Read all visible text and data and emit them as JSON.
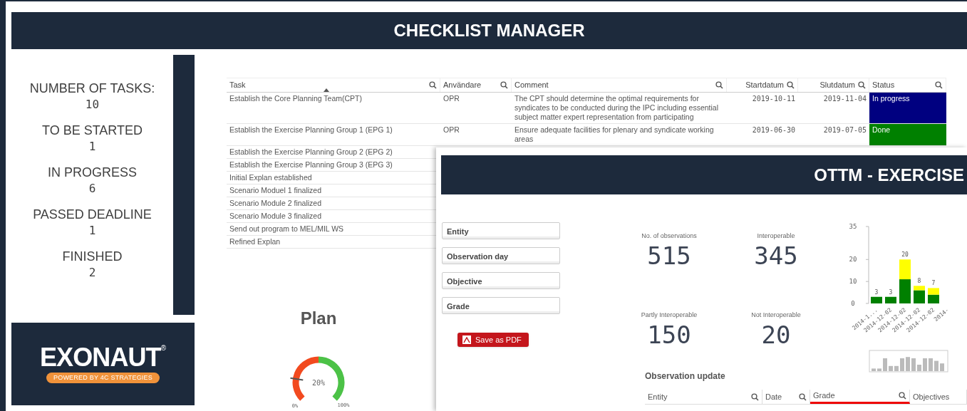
{
  "header": {
    "title": "CHECKLIST MANAGER"
  },
  "summary": [
    {
      "label": "NUMBER OF TASKS:",
      "value": "10"
    },
    {
      "label": "TO BE STARTED",
      "value": "1"
    },
    {
      "label": "IN PROGRESS",
      "value": "6"
    },
    {
      "label": "PASSED DEADLINE",
      "value": "1"
    },
    {
      "label": "FINISHED",
      "value": "2"
    }
  ],
  "logo": {
    "name": "EXONAUT",
    "mark": "®",
    "tagline": "POWERED BY 4C STRATEGIES"
  },
  "task_table": {
    "columns": [
      {
        "label": "Task",
        "sorted": true,
        "kind": "text"
      },
      {
        "label": "Användare",
        "sorted": false,
        "kind": "text"
      },
      {
        "label": "Comment",
        "sorted": false,
        "kind": "text"
      },
      {
        "label": "Startdatum",
        "sorted": false,
        "kind": "date"
      },
      {
        "label": "Slutdatum",
        "sorted": false,
        "kind": "date"
      },
      {
        "label": "Status",
        "sorted": false,
        "kind": "text"
      }
    ],
    "rows": [
      {
        "task": "Establish the Core Planning Team(CPT)",
        "user": "OPR",
        "comment": "The CPT should determine the optimal requirements for syndicates to be conducted during the IPC including essential subject matter expert representation from participating",
        "start": "2019-10-11",
        "end": "2019-11-04",
        "status": "In progress",
        "color": "#000080"
      },
      {
        "task": "Establish the Exercise Planning Group 1 (EPG 1)",
        "user": "OPR",
        "comment": "Ensure adequate facilities for plenary and syndicate working areas",
        "start": "2019-06-30",
        "end": "2019-07-05",
        "status": "Done",
        "color": "#008000"
      },
      {
        "task": "Establish the Exercise Planning Group 2 (EPG 2)"
      },
      {
        "task": "Establish the Exercise Planning Group 3 (EPG 3)"
      },
      {
        "task": "Initial Explan established"
      },
      {
        "task": "Scenario Moduel 1 finalized"
      },
      {
        "task": "Scenario Module 2 finalized"
      },
      {
        "task": "Scenario Module 3 finalized"
      },
      {
        "task": "Send out program to MEL/MIL WS"
      },
      {
        "task": "Refined Explan"
      }
    ]
  },
  "plan": {
    "title": "Plan",
    "level": 0.2,
    "reading": "20%",
    "min_label": "0%",
    "max_label": "100%"
  },
  "exercise_window": {
    "title": "OTTM - EXERCISE",
    "filters": [
      "Entity",
      "Observation day",
      "Objective",
      "Grade"
    ],
    "save_button": "Save as PDF",
    "kpis": [
      {
        "label": "No. of observations",
        "value": "515"
      },
      {
        "label": "Interoperable",
        "value": "345"
      },
      {
        "label": "Partly Interoperable",
        "value": "150"
      },
      {
        "label": "Not Interoperable",
        "value": "20"
      }
    ],
    "chart_data": {
      "type": "bar",
      "stacked": true,
      "categories": [
        "2014-1...",
        "2014-12-02",
        "2014-12-02",
        "2014-12-02",
        "2014-12-02",
        "2014-"
      ],
      "series": [
        {
          "color": "#008000",
          "values": [
            3,
            3,
            11,
            6,
            4,
            null
          ]
        },
        {
          "color": "#ffff00",
          "values": [
            null,
            null,
            9,
            2,
            3,
            null
          ]
        }
      ],
      "ylim": [
        0,
        35
      ],
      "yticks": [
        0,
        10,
        20,
        35
      ],
      "value_labels": [
        "3",
        "3",
        "20",
        "8",
        "7",
        null
      ]
    },
    "observation_update": {
      "title": "Observation update",
      "columns": [
        {
          "label": "Entity",
          "highlighted": false,
          "search_icon": true
        },
        {
          "label": "Date",
          "highlighted": false,
          "search_icon": true
        },
        {
          "label": "Grade",
          "highlighted": true,
          "search_icon": true
        },
        {
          "label": "Objectives",
          "highlighted": false,
          "search_icon": false
        }
      ]
    }
  }
}
